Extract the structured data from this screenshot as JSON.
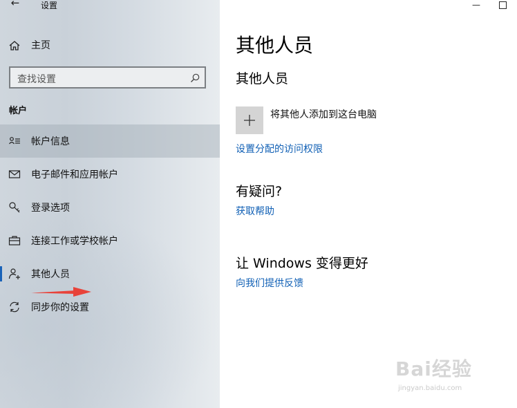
{
  "app": {
    "title": "设置",
    "back_icon": "back-arrow-icon"
  },
  "window": {
    "minimize_icon": "minimize-icon",
    "maximize_icon": "maximize-icon"
  },
  "sidebar": {
    "home_label": "主页",
    "search_placeholder": "查找设置",
    "section_title": "帐户",
    "items": [
      {
        "label": "帐户信息",
        "icon": "account-info-icon",
        "selected": false
      },
      {
        "label": "电子邮件和应用帐户",
        "icon": "mail-icon",
        "selected": false
      },
      {
        "label": "登录选项",
        "icon": "key-icon",
        "selected": false
      },
      {
        "label": "连接工作或学校帐户",
        "icon": "briefcase-icon",
        "selected": false
      },
      {
        "label": "其他人员",
        "icon": "person-add-icon",
        "selected": true
      },
      {
        "label": "同步你的设置",
        "icon": "sync-icon",
        "selected": false
      }
    ]
  },
  "main": {
    "page_title": "其他人员",
    "subsection_title": "其他人员",
    "add_label": "将其他人添加到这台电脑",
    "assigned_access_link": "设置分配的访问权限",
    "question_title": "有疑问?",
    "help_link": "获取帮助",
    "improve_title": "让 Windows 变得更好",
    "feedback_link": "向我们提供反馈"
  },
  "watermark": {
    "text": "Bai经验",
    "url": "jingyan.baidu.com"
  },
  "colors": {
    "accent": "#1a63b8",
    "link": "#1160b5",
    "annotation_arrow": "#e8433a"
  }
}
